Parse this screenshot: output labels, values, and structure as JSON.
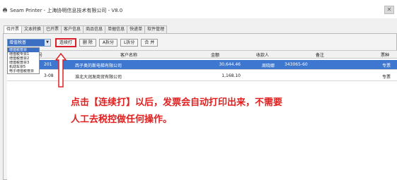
{
  "window": {
    "title": "Seam Printer - 上海协明信息技术有限公司 - V8.0",
    "close_glyph": "✕"
  },
  "tabs": [
    {
      "label": "待开票"
    },
    {
      "label": "文本转换"
    },
    {
      "label": "已开票"
    },
    {
      "label": "客户信息"
    },
    {
      "label": "商品信息"
    },
    {
      "label": "单据信息"
    },
    {
      "label": "快递单"
    },
    {
      "label": "软件管理"
    }
  ],
  "toolbar": {
    "invoice_type_selected": "增值税普",
    "dropdown_arrow": "▼",
    "continuous_print_label": "连续打",
    "delete_label": "删 除",
    "split_a_label": "A拆分",
    "split_b_label": "L拆分",
    "merge_label": "合 并"
  },
  "invoice_type_options": [
    {
      "label": "增值税普票",
      "selected": true
    },
    {
      "label": "增值税专票1"
    },
    {
      "label": "增值税普票2"
    },
    {
      "label": "增值税普票3"
    },
    {
      "label": "机动车票5"
    },
    {
      "label": "电子增值税普票"
    }
  ],
  "grid": {
    "columns": {
      "id": "号",
      "customer": "客户名称",
      "amount": "金额",
      "payee": "收款人",
      "remark": "备注",
      "type": "票种"
    },
    "rows": [
      {
        "id": "201",
        "customer": "西子奥的斯电梯有限公司",
        "amount": "30,644.46",
        "payee": "周晓娜",
        "remark": "343065-60",
        "type": "专票"
      },
      {
        "id": "3-08",
        "customer": "淮北大润发商贸有限公司",
        "amount": "1,168.10",
        "payee": "",
        "remark": "",
        "type": "专票"
      }
    ]
  },
  "annotation": {
    "line1": "点击【连续打】以后，发票会自动打印出来，不需要",
    "line2": "人工去税控做任何操作。"
  },
  "colors": {
    "highlight_red": "#d8222c",
    "selected_row_blue": "#3d77cf",
    "annotation_red": "#e02020"
  }
}
